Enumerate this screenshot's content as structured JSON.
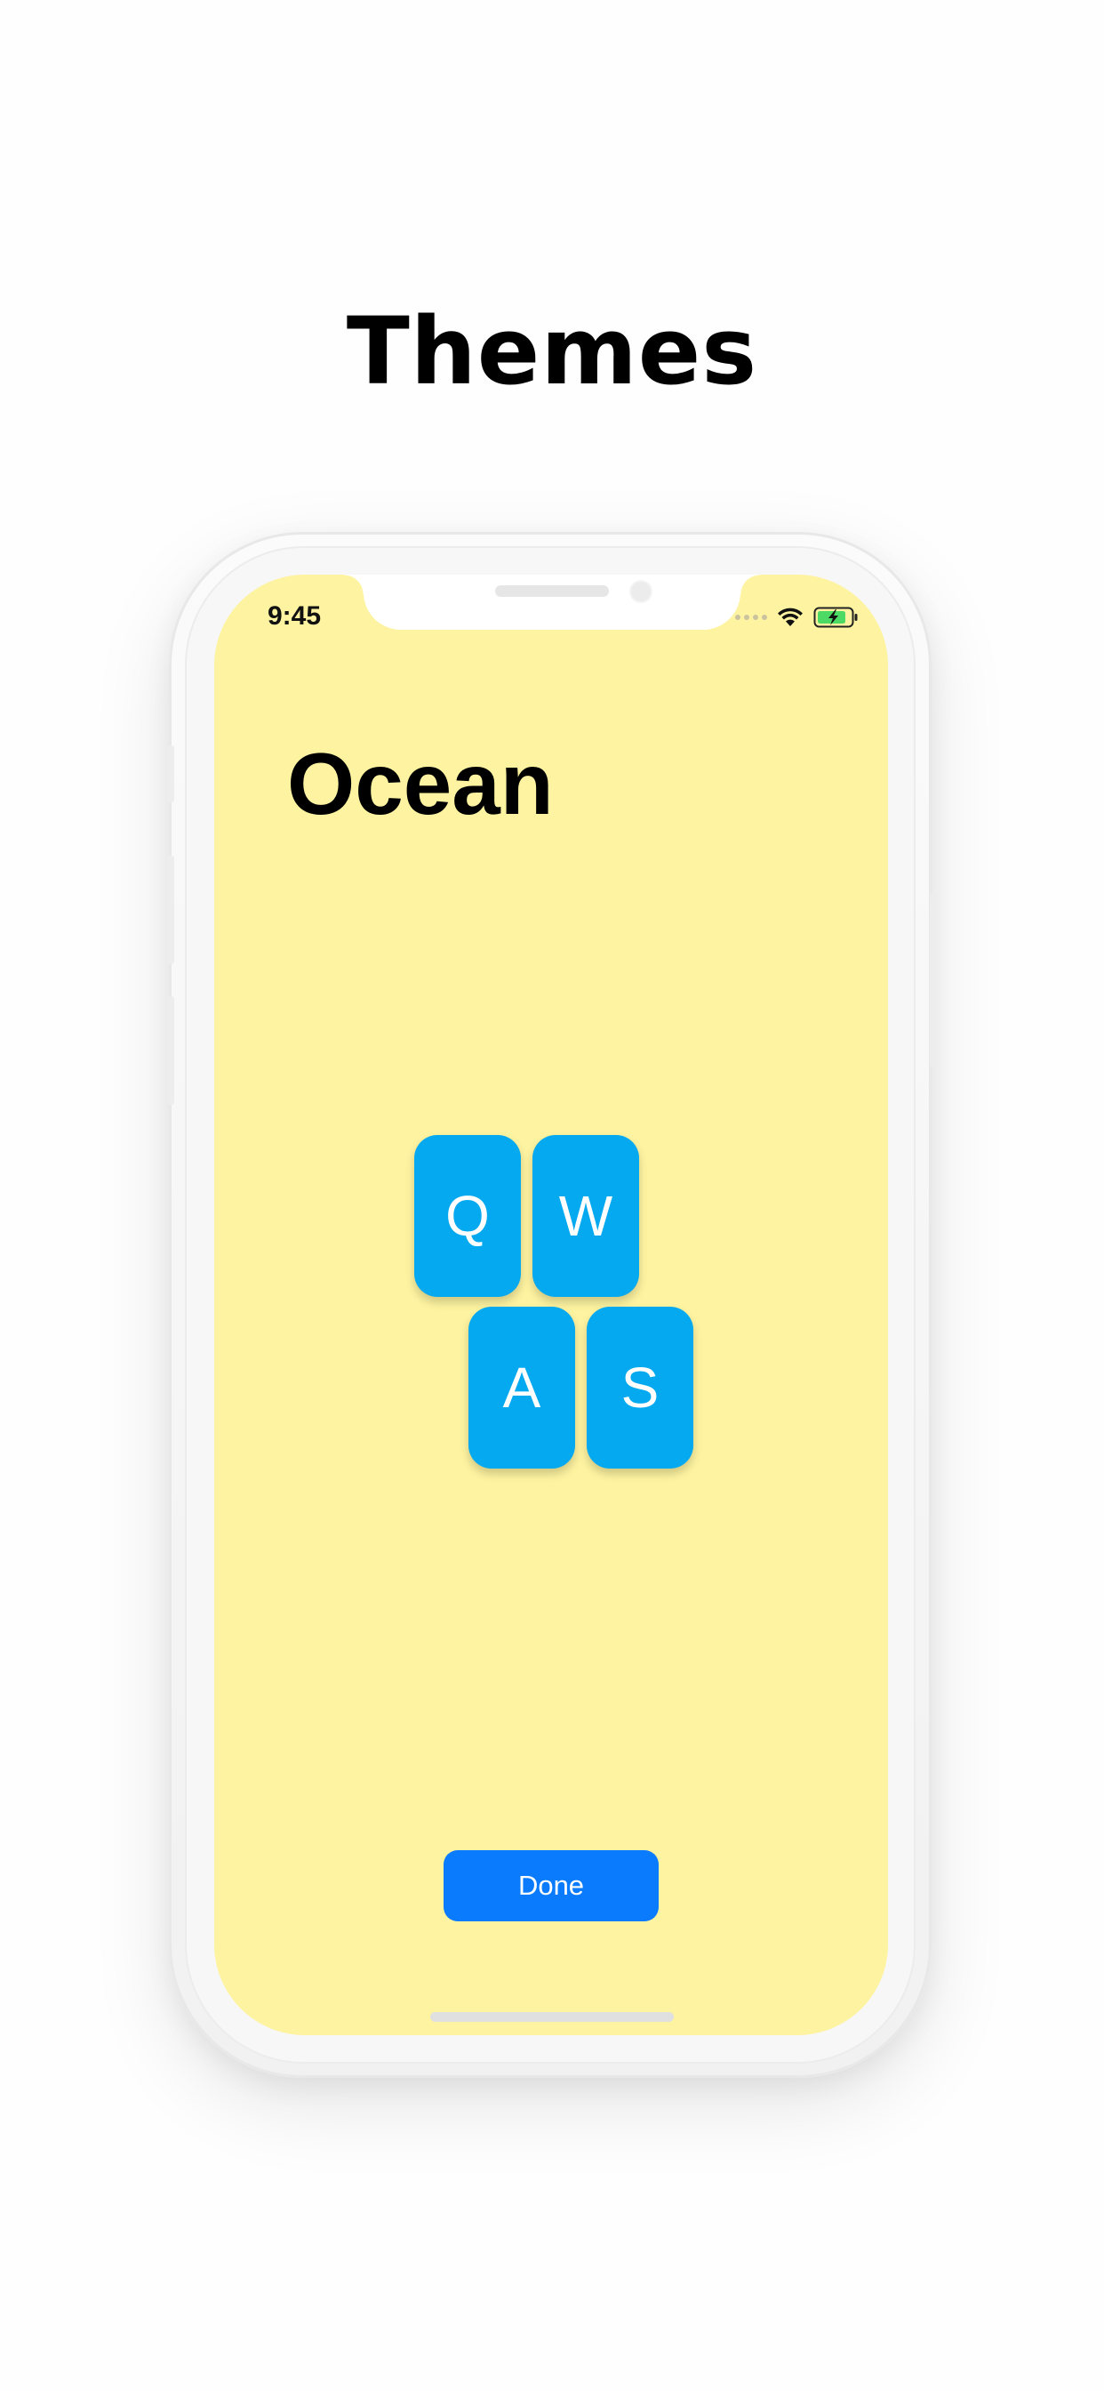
{
  "header": {
    "title": "Themes"
  },
  "status_bar": {
    "time": "9:45",
    "icons": [
      "cellular-signal-icon",
      "wifi-icon",
      "battery-charging-icon"
    ],
    "battery_color": "#4cd964"
  },
  "screen": {
    "background_color": "#fdf3a0",
    "theme_name": "Ocean",
    "keys": [
      "Q",
      "W",
      "A",
      "S"
    ],
    "key_color": "#04a9f0",
    "done_label": "Done",
    "done_color": "#0a7bfd"
  }
}
